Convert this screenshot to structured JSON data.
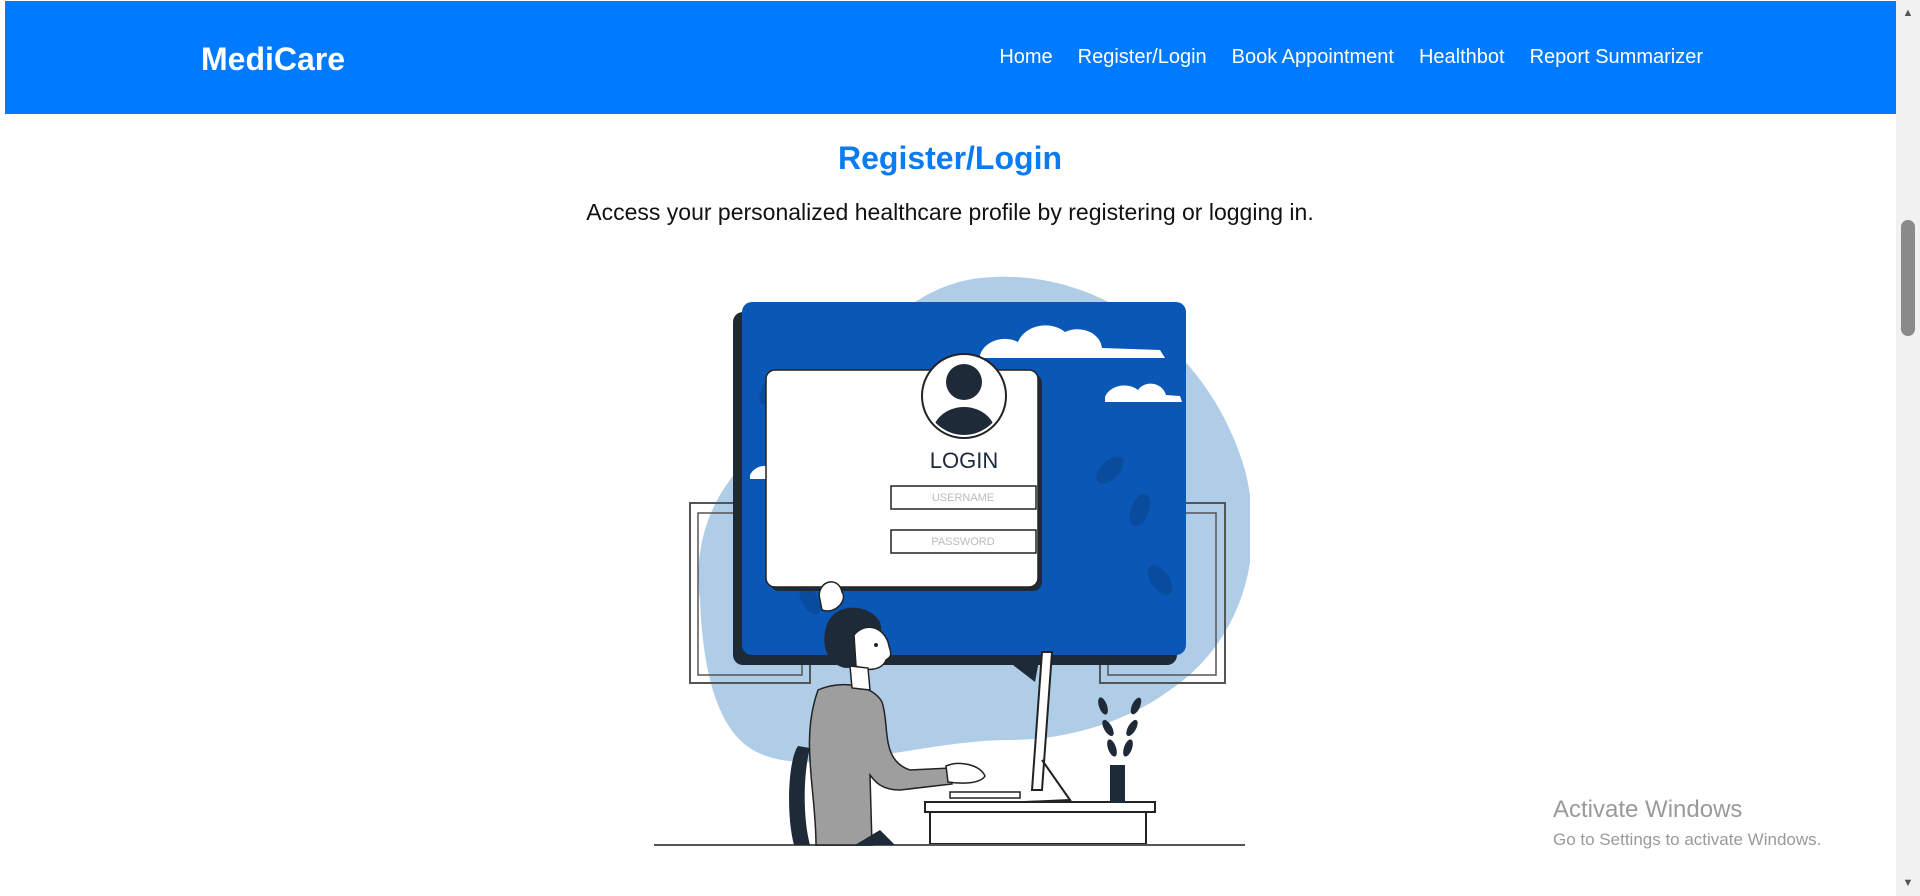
{
  "navbar": {
    "brand": "MediCare",
    "links": [
      "Home",
      "Register/Login",
      "Book Appointment",
      "Healthbot",
      "Report Summarizer"
    ],
    "background": "#007bff"
  },
  "main": {
    "title": "Register/Login",
    "subtitle": "Access your personalized healthcare profile by registering or logging in.",
    "illustration": {
      "heading": "LOGIN",
      "username_placeholder": "USERNAME",
      "password_placeholder": "PASSWORD"
    }
  },
  "watermark": {
    "line1": "Activate Windows",
    "line2": "Go to Settings to activate Windows."
  },
  "colors": {
    "accent": "#0a7bf0",
    "illustration_blue": "#0b57b5",
    "illustration_light": "#b0cde8"
  }
}
